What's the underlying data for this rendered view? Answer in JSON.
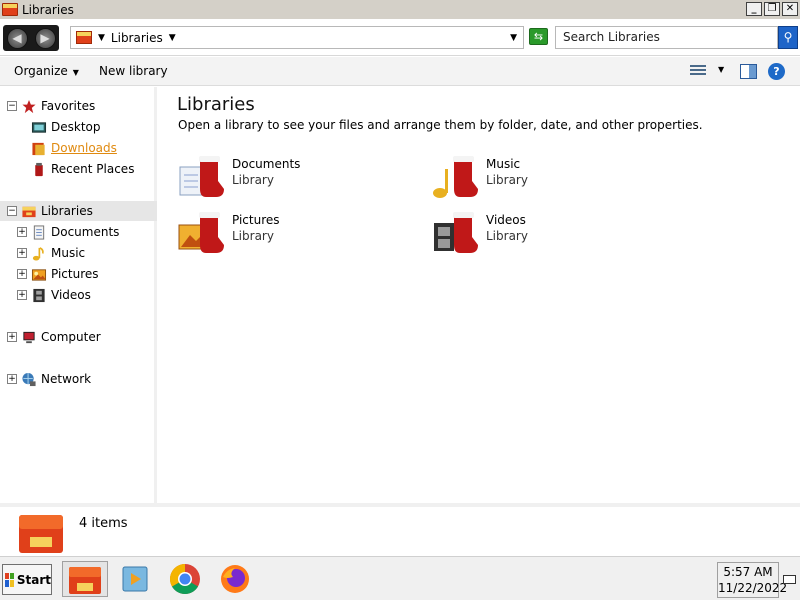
{
  "window": {
    "title": "Libraries",
    "buttons": [
      "_",
      "❐",
      "✕"
    ]
  },
  "addressbar": {
    "path": "Libraries",
    "search_placeholder": "Search Libraries"
  },
  "toolbar": {
    "organize": "Organize",
    "new_library": "New library"
  },
  "nav": {
    "favorites": "Favorites",
    "desktop": "Desktop",
    "downloads": "Downloads",
    "recent_places": "Recent Places",
    "libraries": "Libraries",
    "documents": "Documents",
    "music": "Music",
    "pictures": "Pictures",
    "videos": "Videos",
    "computer": "Computer",
    "network": "Network"
  },
  "content": {
    "title": "Libraries",
    "subtitle": "Open a library to see your files and arrange them by folder, date, and other properties.",
    "items": [
      {
        "name": "Documents",
        "type": "Library"
      },
      {
        "name": "Music",
        "type": "Library"
      },
      {
        "name": "Pictures",
        "type": "Library"
      },
      {
        "name": "Videos",
        "type": "Library"
      }
    ]
  },
  "details": {
    "count": "4 items"
  },
  "taskbar": {
    "start": "Start",
    "time": "5:57 AM",
    "date": "11/22/2022"
  },
  "colors": {
    "accent": "#1e64c8",
    "link_hover": "#e08a10",
    "library_red": "#e0401a"
  }
}
